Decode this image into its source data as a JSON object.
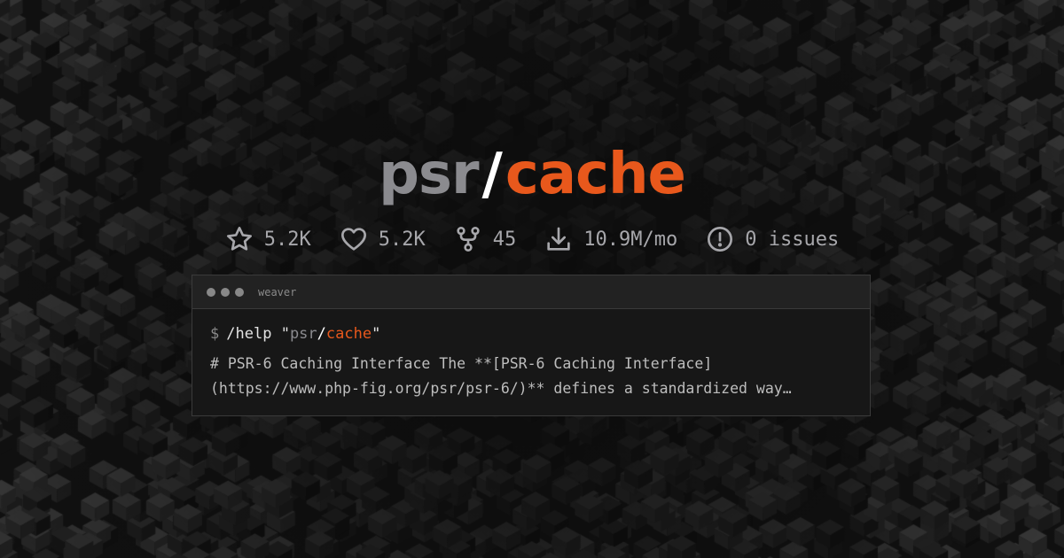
{
  "header": {
    "vendor": "psr",
    "slash": "/",
    "package": "cache"
  },
  "stats": [
    {
      "icon": "star-icon",
      "value": "5.2K"
    },
    {
      "icon": "heart-icon",
      "value": "5.2K"
    },
    {
      "icon": "fork-icon",
      "value": "45"
    },
    {
      "icon": "download-icon",
      "value": "10.9M/mo"
    },
    {
      "icon": "alert-circle-icon",
      "value": "0 issues"
    }
  ],
  "terminal": {
    "title": "weaver",
    "prompt": "$",
    "command": "/help",
    "quote_open": "\"",
    "arg_vendor": "psr",
    "arg_slash": "/",
    "arg_package": "cache",
    "quote_close": "\"",
    "output_lines": [
      "# PSR-6 Caching Interface The **[PSR-6 Caching Interface]",
      "(https://www.php-fig.org/psr/psr-6/)** defines a standardized way…"
    ]
  },
  "colors": {
    "background": "#111111",
    "vendor": "#8b8b8f",
    "accent": "#e8581c",
    "stat_text": "#a7a7ab"
  }
}
